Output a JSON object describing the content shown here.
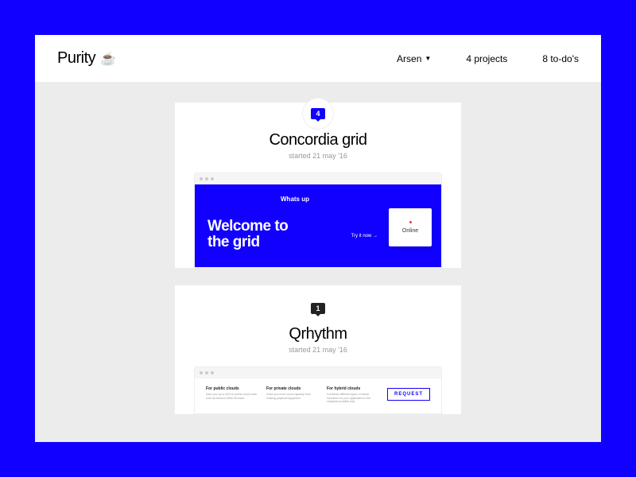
{
  "header": {
    "brand": "Purity",
    "user": "Arsen",
    "projects": "4 projects",
    "todos": "8 to-do's"
  },
  "cards": [
    {
      "badge": "4",
      "title": "Concordia grid",
      "subtitle": "started 21 may '16",
      "preview": {
        "whats": "Whats up",
        "welcome_line1": "Welcome to",
        "welcome_line2": "the grid",
        "try": "Try it now →",
        "online": "Online"
      }
    },
    {
      "badge": "1",
      "title": "Qrhythm",
      "subtitle": "started 21 may '16",
      "preview": {
        "col1_title": "For public clouds",
        "col1_text": "Save you up to 40% of public cloud costs such as Amazon Web Services",
        "col2_title": "For private clouds",
        "col2_text": "Gives you more cloud capacity from existing physical equipment",
        "col3_title": "For hybrid clouds",
        "col3_text": "Combines different types of virtual machines for your application in the cheapest possible way",
        "request": "REQUEST"
      }
    }
  ]
}
